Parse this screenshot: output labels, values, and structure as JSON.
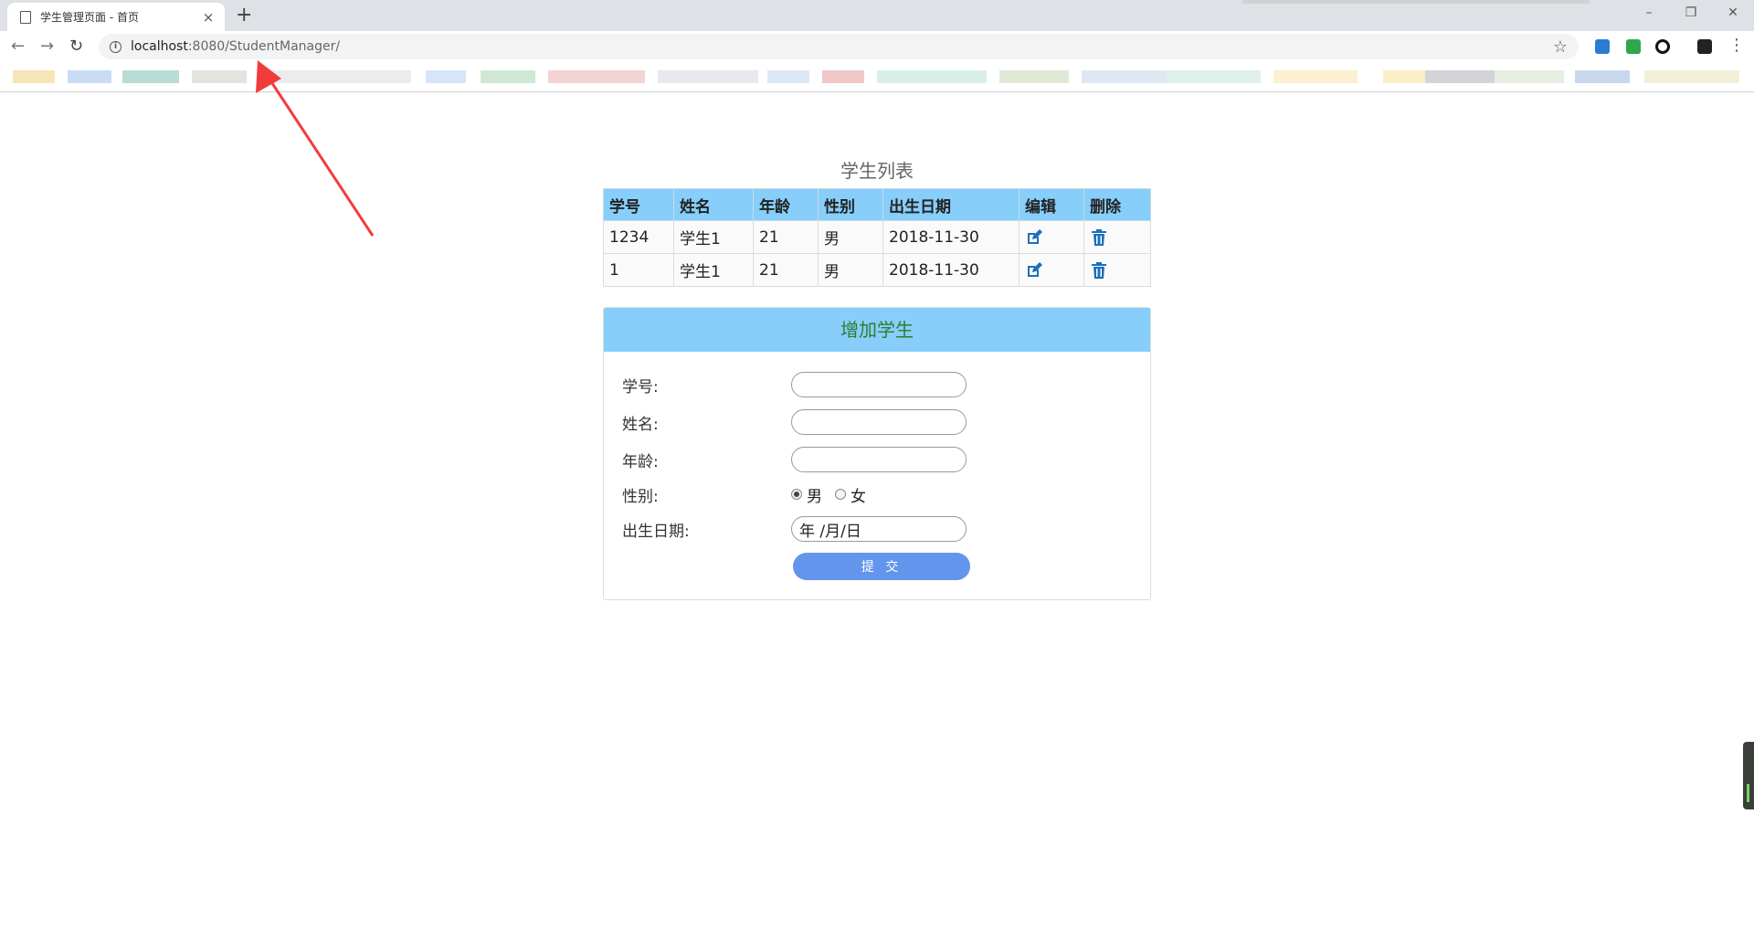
{
  "browser": {
    "tab_title": "学生管理页面 - 首页",
    "url_host": "localhost",
    "url_rest": ":8080/StudentManager/",
    "new_tab": "+",
    "close": "×",
    "win_min": "–",
    "win_restore": "❐",
    "win_close": "✕"
  },
  "list": {
    "title": "学生列表",
    "headers": [
      "学号",
      "姓名",
      "年龄",
      "性别",
      "出生日期",
      "编辑",
      "删除"
    ],
    "rows": [
      [
        "1234",
        "学生1",
        "21",
        "男",
        "2018-11-30"
      ],
      [
        "1",
        "学生1",
        "21",
        "男",
        "2018-11-30"
      ]
    ]
  },
  "form": {
    "title": "增加学生",
    "id_label": "学号:",
    "name_label": "姓名:",
    "age_label": "年龄:",
    "gender_label": "性别:",
    "gender_male": "男",
    "gender_female": "女",
    "birth_label": "出生日期:",
    "date_placeholder": "年 /月/日",
    "submit": "提 交"
  },
  "colors": {
    "header_bg": "#87cefa",
    "panel_title": "#2e7d32",
    "submit_bg": "#6495ed",
    "icon_blue": "#1e6fb8",
    "annotation": "#f23b3b"
  },
  "icons": {
    "edit": "edit-icon",
    "delete": "trash-icon"
  }
}
